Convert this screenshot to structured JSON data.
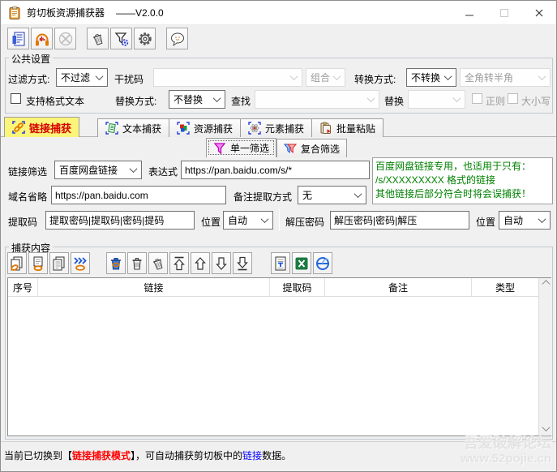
{
  "window": {
    "title": "剪切板资源捕获器",
    "version": "——V2.0.0"
  },
  "colors": {
    "active_tab_bg": "#fbf579",
    "active_tab_text": "#d40000",
    "hint_green": "#008000",
    "status_red": "#ff0000",
    "status_blue": "#0000ff",
    "chain_orange": "#e07800",
    "bracket_blue": "#2b3fd6"
  },
  "icons": {
    "titlebar": [
      "clipboard-app-icon",
      "minimize-icon",
      "maximize-icon",
      "close-icon"
    ],
    "main_toolbar": [
      "document-icon",
      "headphones-monitor-icon",
      "stop-monitor-icon",
      "clear-trash-icon",
      "filter-settings-icon",
      "gear-icon",
      "about-bubble-icon"
    ],
    "tab_icons": [
      "chain-link-icon",
      "green-text-icon",
      "rgb-cube-icon",
      "atom-icon",
      "clipboard-paste-icon"
    ],
    "subtab_icons": [
      "funnel-single-icon",
      "funnel-double-icon"
    ],
    "capture_toolbar": [
      "copy-link-icon",
      "page-link-icon",
      "copy-pages-icon",
      "open-links-icon",
      "trash-link-icon",
      "trash-icon",
      "trash-tilted-icon",
      "move-top-icon",
      "move-up-icon",
      "move-down-icon",
      "move-bottom-icon",
      "export-text-icon",
      "export-excel-icon",
      "open-browser-icon"
    ]
  },
  "common": {
    "legend": "公共设置",
    "filter_mode_label": "过滤方式:",
    "filter_mode_value": "不过滤",
    "noise_label": "干扰码",
    "noise_value": "",
    "combine_value": "组合",
    "convert_label": "转换方式:",
    "convert_value": "不转换",
    "convert_target_value": "全角转半角",
    "rich_text_label": "支持格式文本",
    "replace_mode_label": "替换方式:",
    "replace_mode_value": "不替换",
    "find_label": "查找",
    "find_value": "",
    "replace_label": "替换",
    "replace_value": "",
    "regex_label": "正则",
    "case_label": "大小写"
  },
  "tabs": [
    {
      "label": "链接捕获"
    },
    {
      "label": "文本捕获"
    },
    {
      "label": "资源捕获"
    },
    {
      "label": "元素捕获"
    },
    {
      "label": "批量粘贴"
    }
  ],
  "subtabs": [
    {
      "label": "单一筛选"
    },
    {
      "label": "复合筛选"
    }
  ],
  "filter": {
    "link_filter_label": "链接筛选",
    "link_filter_value": "百度网盘链接",
    "expression_label": "表达式",
    "expression_value": "https://pan.baidu.com/s/*",
    "hint_line1": "百度网盘链接专用，也适用于只有：",
    "hint_line2": "/s/XXXXXXXXX 格式的链接",
    "hint_line3": "其他链接后部分符合时将会误捕获！",
    "domain_label": "域名省略",
    "domain_value": "https://pan.baidu.com",
    "remark_label": "备注提取方式",
    "remark_value": "无",
    "code_label": "提取码",
    "code_value": "提取密码|提取码|密码|提码",
    "pos_label": "位置",
    "pos_value": "自动",
    "unzip_label": "解压密码",
    "unzip_value": "解压密码|密码|解压",
    "pos2_label": "位置",
    "pos2_value": "自动"
  },
  "capture": {
    "legend": "捕获内容"
  },
  "table": {
    "columns": [
      "序号",
      "链接",
      "提取码",
      "备注",
      "类型"
    ],
    "rows": []
  },
  "status": {
    "part1": "当前已切换到【",
    "mode": "链接捕获模式",
    "part2": "】，可自动捕获剪切板中的",
    "link_word": "链接",
    "part3": "数据。"
  },
  "watermark": {
    "line1": "吾爱破解论坛",
    "line2": "www.52pojie.cn"
  }
}
